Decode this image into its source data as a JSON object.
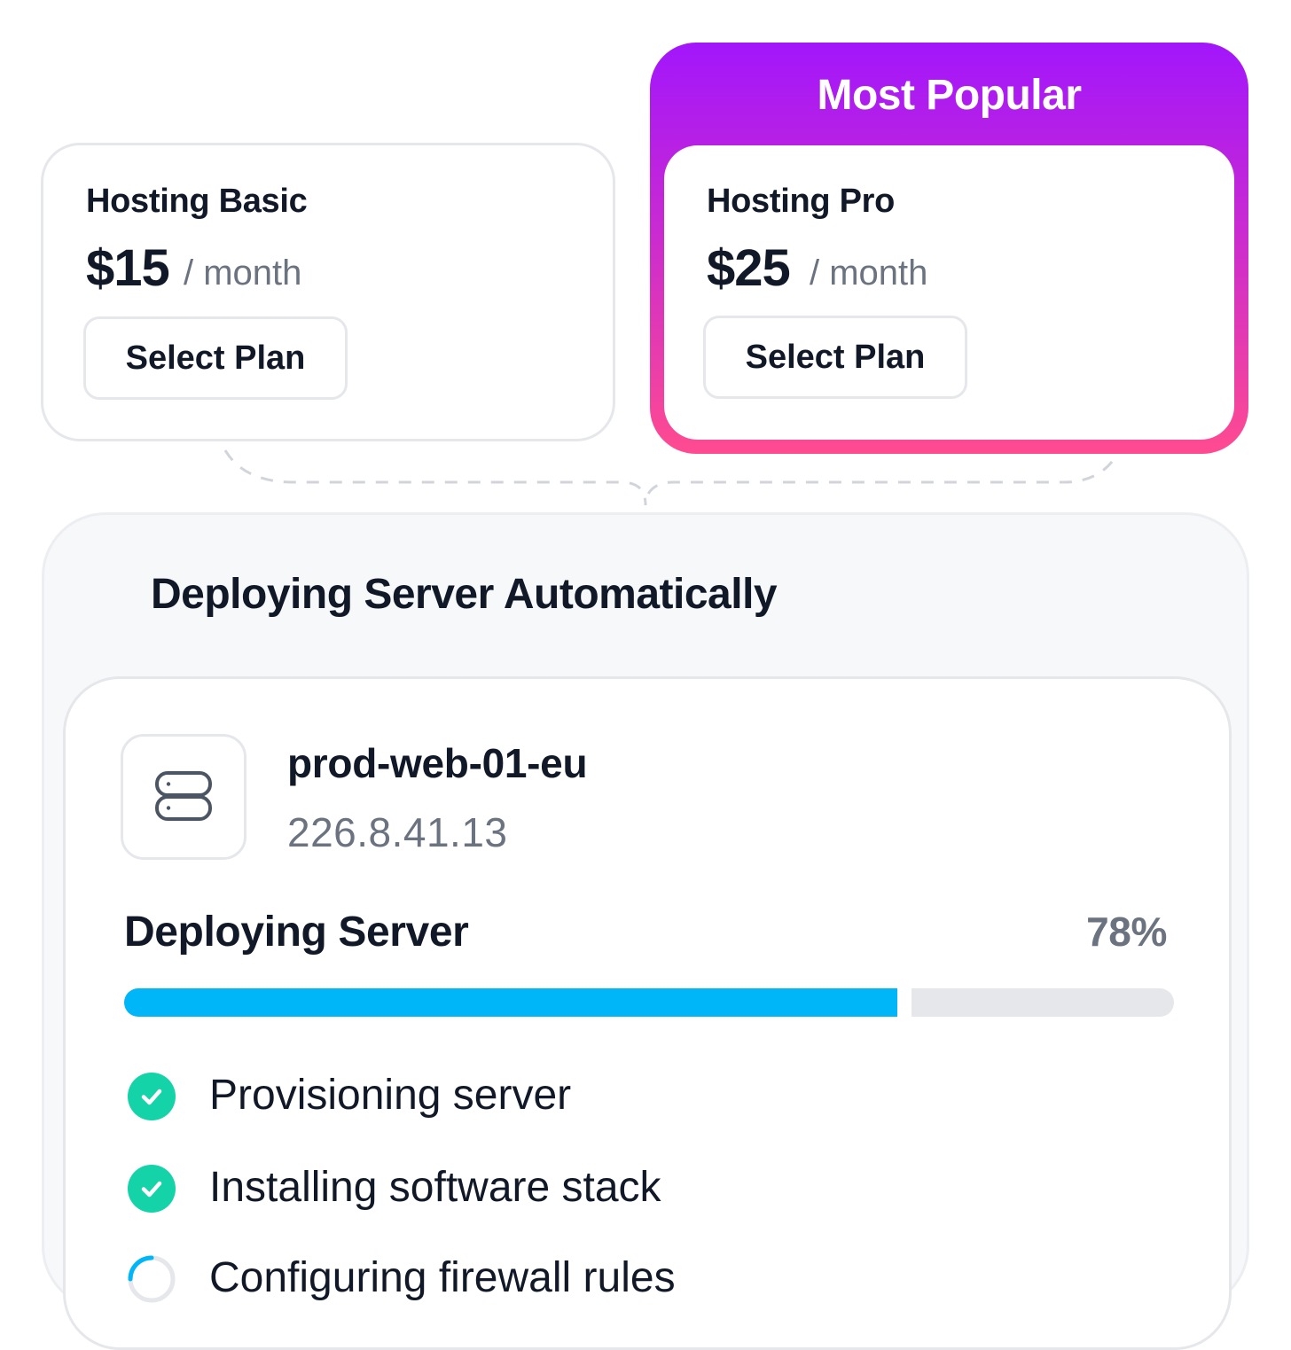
{
  "plans": [
    {
      "name": "Hosting Basic",
      "price": "$15",
      "period": "/ month",
      "button": "Select Plan"
    },
    {
      "name": "Hosting Pro",
      "price": "$25",
      "period": "/ month",
      "button": "Select Plan",
      "badge": "Most Popular"
    }
  ],
  "deploy": {
    "title": "Deploying Server Automatically",
    "server": {
      "icon": "server-icon",
      "name": "prod-web-01-eu",
      "ip": "226.8.41.13"
    },
    "progress": {
      "label": "Deploying Server",
      "percent_text": "78%",
      "value": 0.78
    },
    "steps": [
      {
        "label": "Provisioning server",
        "status": "done"
      },
      {
        "label": "Installing software stack",
        "status": "done"
      },
      {
        "label": "Configuring firewall rules",
        "status": "in-progress"
      }
    ]
  },
  "colors": {
    "accent_progress": "#00b6f8",
    "success": "#14d3a8",
    "popular_gradient_top": "#a216fb",
    "popular_gradient_bottom": "#ff4b90"
  }
}
